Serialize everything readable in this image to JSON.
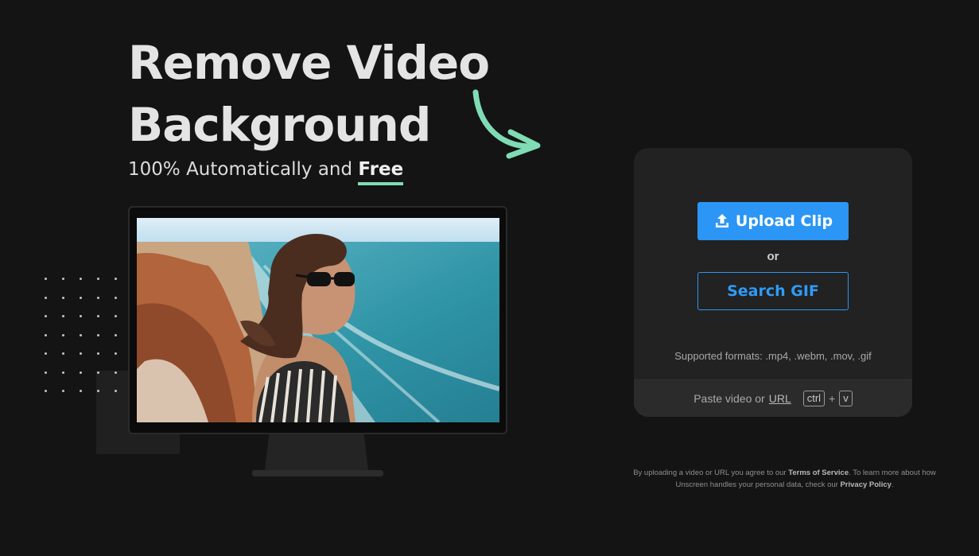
{
  "hero": {
    "title_line1": "Remove Video",
    "title_line2": "Background",
    "subtitle_prefix": "100% Automatically and",
    "subtitle_highlight": "Free"
  },
  "upload_card": {
    "upload_button": "Upload Clip",
    "or_label": "or",
    "search_gif_button": "Search GIF",
    "supported_formats": "Supported formats: .mp4, .webm, .mov, .gif",
    "paste_prefix": "Paste video or",
    "paste_url_link": "URL",
    "shortcut_key1": "ctrl",
    "shortcut_plus": "+",
    "shortcut_key2": "v"
  },
  "legal": {
    "part1": "By uploading a video or URL you agree to our",
    "terms_link": "Terms of Service",
    "part2": ". To learn more about how Unscreen handles your personal data, check our",
    "privacy_link": "Privacy Policy",
    "part3": "."
  },
  "colors": {
    "background": "#141414",
    "primary_blue": "#2b96f5",
    "accent_green": "#7fdcb5",
    "card_bg": "#222222"
  },
  "icons": [
    "upload-icon",
    "curved-arrow-icon"
  ]
}
